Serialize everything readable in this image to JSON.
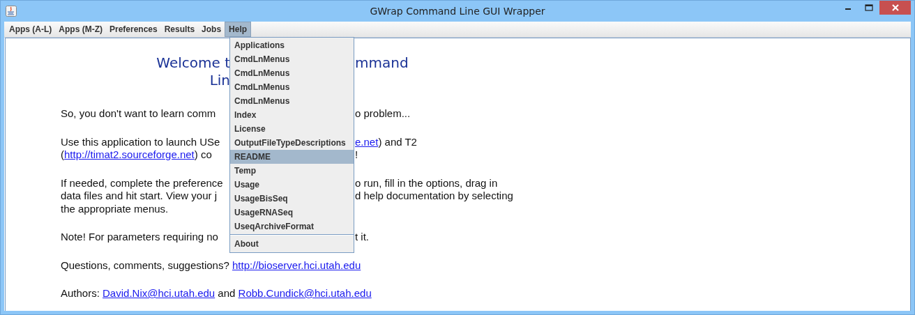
{
  "window": {
    "title": "GWrap Command Line GUI Wrapper"
  },
  "menubar": [
    {
      "label": "Apps (A-L)",
      "selected": false
    },
    {
      "label": "Apps (M-Z)",
      "selected": false
    },
    {
      "label": "Preferences",
      "selected": false
    },
    {
      "label": "Results",
      "selected": false
    },
    {
      "label": "Jobs",
      "selected": false
    },
    {
      "label": "Help",
      "selected": true
    }
  ],
  "help_menu": {
    "sections": [
      [
        {
          "label": "Applications",
          "selected": false
        },
        {
          "label": "CmdLnMenus",
          "selected": false
        },
        {
          "label": "CmdLnMenus",
          "selected": false
        },
        {
          "label": "CmdLnMenus",
          "selected": false
        },
        {
          "label": "CmdLnMenus",
          "selected": false
        },
        {
          "label": "Index",
          "selected": false
        },
        {
          "label": "License",
          "selected": false
        },
        {
          "label": "OutputFileTypeDescriptions",
          "selected": false
        },
        {
          "label": "README",
          "selected": true
        },
        {
          "label": "Temp",
          "selected": false
        },
        {
          "label": "Usage",
          "selected": false
        },
        {
          "label": "UsageBisSeq",
          "selected": false
        },
        {
          "label": "UsageRNASeq",
          "selected": false
        },
        {
          "label": "UseqArchiveFormat",
          "selected": false
        }
      ],
      [
        {
          "label": "About",
          "selected": false
        }
      ]
    ]
  },
  "content": [
    {
      "kind": "heading",
      "lines": [
        {
          "left": [
            {
              "t": "Welcome t",
              "kind": "text"
            }
          ],
          "right": [
            {
              "t": "mmand",
              "kind": "text"
            }
          ]
        },
        {
          "left": [
            {
              "t": "Lin",
              "kind": "text"
            }
          ]
        }
      ]
    },
    {
      "kind": "paragraph",
      "lines": [
        {
          "left": [
            {
              "t": "So, you don't want to learn comm",
              "kind": "text"
            }
          ],
          "right": [
            {
              "t": "o problem...",
              "kind": "text"
            }
          ]
        }
      ]
    },
    {
      "kind": "paragraph",
      "lines": [
        {
          "left": [
            {
              "t": "Use this application to launch USe",
              "kind": "text"
            }
          ],
          "right": [
            {
              "t": "e.net",
              "kind": "link"
            },
            {
              "t": ") and T2",
              "kind": "text"
            }
          ]
        },
        {
          "left": [
            {
              "t": "(",
              "kind": "text"
            },
            {
              "t": "http://timat2.sourceforge.net",
              "kind": "link"
            },
            {
              "t": ") co",
              "kind": "text"
            }
          ],
          "right": [
            {
              "t": "!",
              "kind": "text"
            }
          ]
        }
      ]
    },
    {
      "kind": "paragraph",
      "lines": [
        {
          "left": [
            {
              "t": "If needed, complete the preference",
              "kind": "text"
            }
          ],
          "right": [
            {
              "t": "o run, fill in the options, drag in",
              "kind": "text"
            }
          ]
        },
        {
          "left": [
            {
              "t": "data files and hit start. View your j",
              "kind": "text"
            }
          ],
          "right": [
            {
              "t": "d help documentation by selecting",
              "kind": "text"
            }
          ]
        },
        {
          "left": [
            {
              "t": "the appropriate menus.",
              "kind": "text"
            }
          ]
        }
      ]
    },
    {
      "kind": "paragraph",
      "lines": [
        {
          "left": [
            {
              "t": "Note! For parameters requiring no",
              "kind": "text"
            }
          ],
          "right": [
            {
              "t": "t it.",
              "kind": "text"
            }
          ]
        }
      ]
    },
    {
      "kind": "paragraph",
      "lines": [
        {
          "left": [
            {
              "t": "Questions, comments, suggestions? ",
              "kind": "text"
            },
            {
              "t": "http://bioserver.hci.utah.edu",
              "kind": "link"
            }
          ]
        }
      ]
    },
    {
      "kind": "paragraph",
      "lines": [
        {
          "left": [
            {
              "t": "Authors: ",
              "kind": "text"
            },
            {
              "t": "David.Nix@hci.utah.edu",
              "kind": "link"
            },
            {
              "t": " and ",
              "kind": "text"
            },
            {
              "t": "Robb.Cundick@hci.utah.edu",
              "kind": "link"
            }
          ]
        }
      ]
    }
  ]
}
